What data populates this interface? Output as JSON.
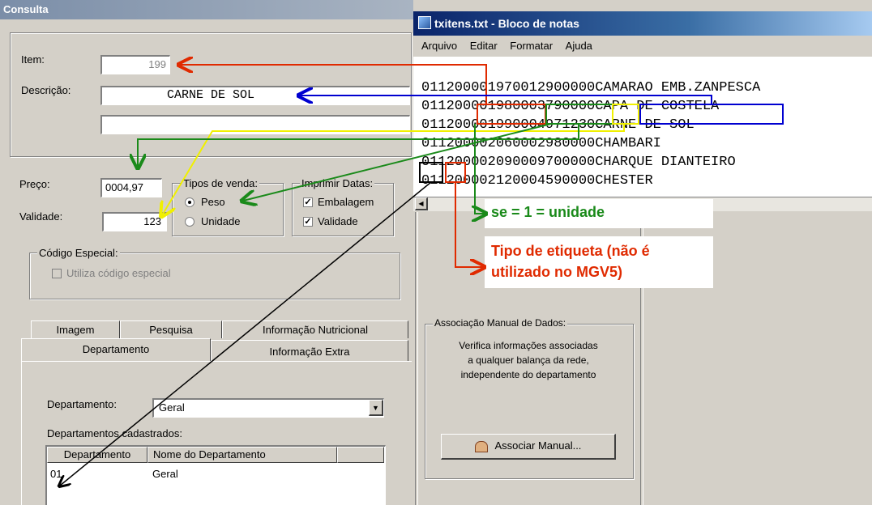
{
  "consulta": {
    "title": "Consulta",
    "item_label": "Item:",
    "item_value": "199",
    "descricao_label": "Descrição:",
    "descricao_value": "CARNE DE SOL",
    "preco_label": "Preço:",
    "preco_value": "0004,97",
    "validade_label": "Validade:",
    "validade_value": "123",
    "tipos_venda": {
      "legend": "Tipos de venda:",
      "peso": "Peso",
      "unidade": "Unidade",
      "selected": "Peso"
    },
    "imprimir_datas": {
      "legend": "Imprimir Datas:",
      "embalagem": "Embalagem",
      "validade": "Validade"
    },
    "codigo_especial": {
      "legend": "Código Especial:",
      "checkbox": "Utiliza código especial"
    },
    "tabs_row1": [
      "Imagem",
      "Pesquisa",
      "Informação Nutricional"
    ],
    "tabs_row2": [
      "Departamento",
      "Informação Extra"
    ],
    "departamento_label": "Departamento:",
    "departamento_value": "Geral",
    "cadastrados_label": "Departamentos cadastrados:",
    "table_headers": [
      "Departamento",
      "Nome do Departamento"
    ],
    "table_rows": [
      [
        "01",
        "Geral"
      ]
    ]
  },
  "notepad": {
    "title": "txitens.txt - Bloco de notas",
    "menu": [
      "Arquivo",
      "Editar",
      "Formatar",
      "Ajuda"
    ],
    "lines": [
      "011200001970012900000CAMARAO EMB.ZANPESCA",
      "011200001980003790000CAPA DE COSTELA",
      "011200001990004971230CARNE DE SOL",
      "011200002060002980000CHAMBARI",
      "011200002090009700000CHARQUE DIANTEIRO",
      "011200002120004590000CHESTER"
    ]
  },
  "annotations": {
    "unidade_note": "se = 1 = unidade",
    "etiqueta_note_1": "Tipo de etiqueta (não é",
    "etiqueta_note_2": "utilizado no MGV5)"
  },
  "associacao": {
    "legend": "Associação Manual de Dados:",
    "text_1": "Verifica informações associadas",
    "text_2": "a qualquer balança da rede,",
    "text_3": "independente do departamento",
    "button": "Associar Manual..."
  },
  "colors": {
    "red": "#e02a00",
    "blue": "#0000d0",
    "green": "#1a8a1a",
    "yellow": "#f0f000",
    "black": "#000000"
  }
}
